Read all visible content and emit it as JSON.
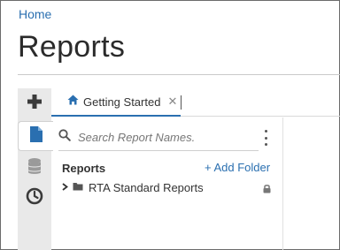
{
  "breadcrumb": {
    "home_label": "Home"
  },
  "page": {
    "title": "Reports"
  },
  "rail": {
    "items": [
      {
        "icon": "plus-icon"
      },
      {
        "icon": "document-icon",
        "active": true
      },
      {
        "icon": "database-icon"
      },
      {
        "icon": "clock-icon"
      }
    ]
  },
  "tabs": [
    {
      "label": "Getting Started",
      "icon": "home-icon",
      "active": true
    }
  ],
  "panel": {
    "search_placeholder": "Search Report Names.",
    "section_title": "Reports",
    "add_folder_label": "+ Add Folder",
    "tree": [
      {
        "label": "RTA Standard Reports",
        "locked": true
      }
    ]
  },
  "colors": {
    "accent": "#2a6fb0",
    "rail_bg": "#e9e9e9"
  }
}
